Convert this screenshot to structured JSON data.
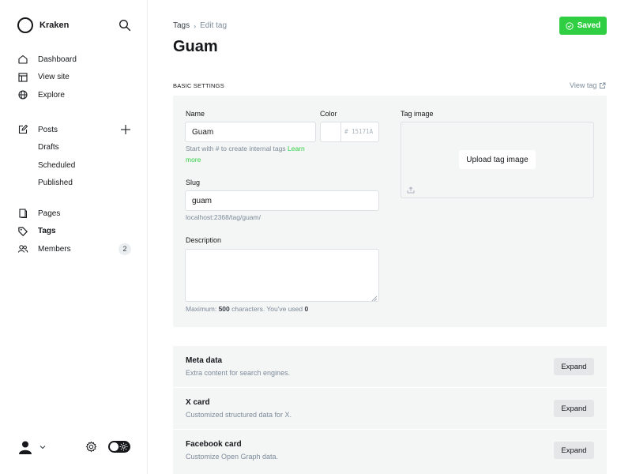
{
  "app": {
    "name": "Kraken"
  },
  "sidebar": {
    "primary": [
      {
        "label": "Dashboard",
        "icon": "home-icon"
      },
      {
        "label": "View site",
        "icon": "layout-icon"
      },
      {
        "label": "Explore",
        "icon": "globe-icon"
      }
    ],
    "content": [
      {
        "label": "Posts",
        "icon": "edit-icon"
      },
      {
        "label": "Drafts"
      },
      {
        "label": "Scheduled"
      },
      {
        "label": "Published"
      }
    ],
    "other": [
      {
        "label": "Pages",
        "icon": "pages-icon"
      },
      {
        "label": "Tags",
        "icon": "tag-icon",
        "active": true
      },
      {
        "label": "Members",
        "icon": "members-icon",
        "count": "2"
      }
    ]
  },
  "header": {
    "breadcrumb": [
      "Tags",
      "Edit tag"
    ],
    "title": "Guam",
    "saved_label": "Saved"
  },
  "basic": {
    "heading": "Basic settings",
    "view_tag": "View tag",
    "name_label": "Name",
    "name_value": "Guam",
    "name_hint": "Start with # to create internal tags",
    "name_hint_link": "Learn more",
    "color_label": "Color",
    "color_value": "15171A",
    "color_placeholder": "# 15171A",
    "slug_label": "Slug",
    "slug_value": "guam",
    "slug_url": "localhost:2368/tag/guam/",
    "description_label": "Description",
    "description_value": "",
    "description_hint_prefix": "Maximum:",
    "description_max": "500",
    "description_hint_mid": "characters. You've used",
    "description_used": "0",
    "tag_image_label": "Tag image",
    "upload_label": "Upload tag image"
  },
  "cards": [
    {
      "title": "Meta data",
      "desc": "Extra content for search engines.",
      "button": "Expand"
    },
    {
      "title": "X card",
      "desc": "Customized structured data for X.",
      "button": "Expand"
    },
    {
      "title": "Facebook card",
      "desc": "Customize Open Graph data.",
      "button": "Expand"
    }
  ],
  "colors": {
    "accent": "#30cf43",
    "text": "#15171a",
    "muted": "#7c8b9a",
    "panel": "#f4f5f5",
    "tag_color": "#15171a"
  }
}
